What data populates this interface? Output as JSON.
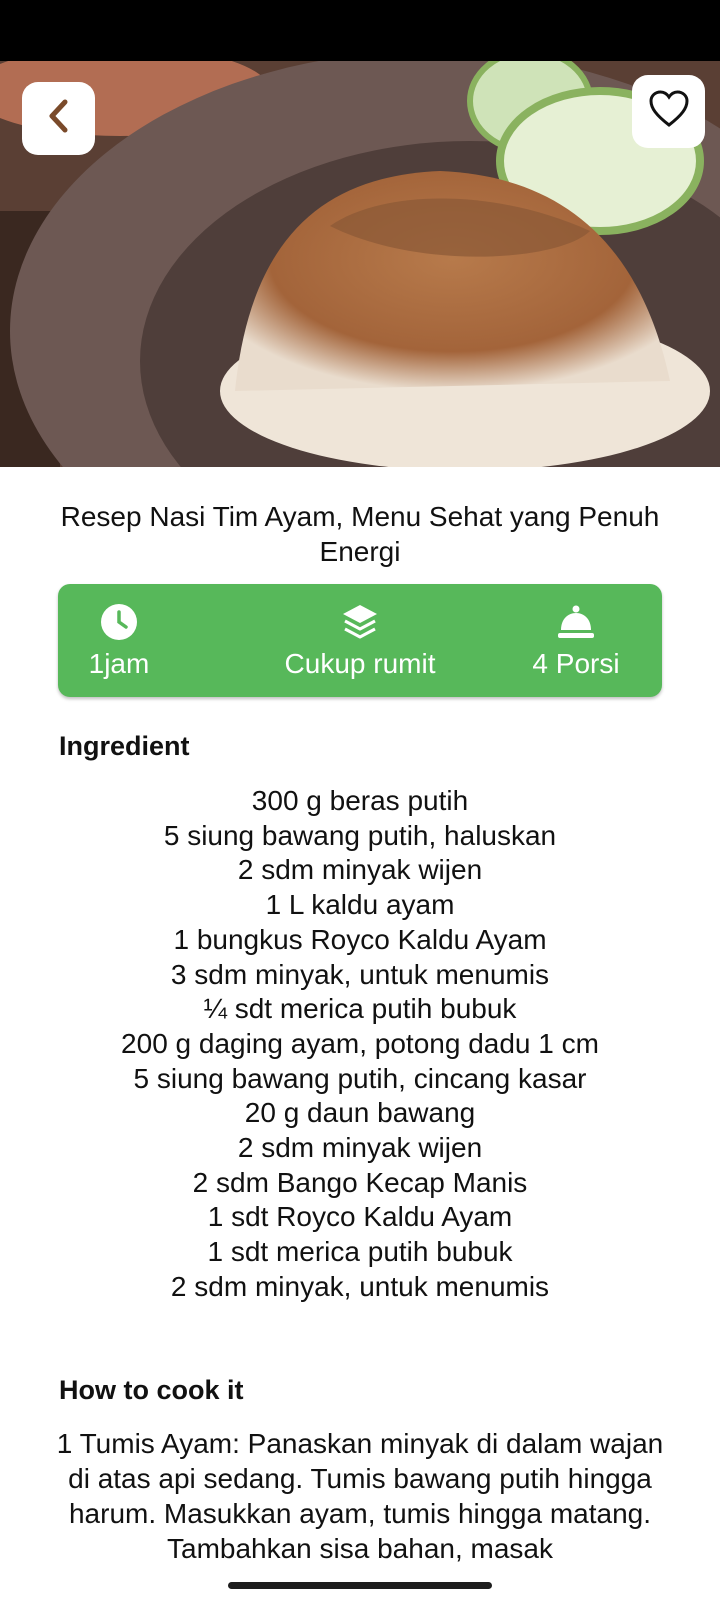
{
  "recipe": {
    "title": "Resep Nasi Tim Ayam, Menu Sehat yang Penuh Energi",
    "info": {
      "duration": "1jam",
      "difficulty": "Cukup rumit",
      "servings": "4 Porsi"
    },
    "ingredients_heading": "Ingredient",
    "ingredients": [
      "300 g beras putih",
      "5 siung bawang putih, haluskan",
      "2 sdm minyak wijen",
      "1 L kaldu ayam",
      "1 bungkus Royco Kaldu Ayam",
      "3 sdm minyak, untuk menumis",
      "¼ sdt merica putih bubuk",
      "200 g daging ayam, potong dadu 1 cm",
      "5 siung bawang putih, cincang kasar",
      "20 g daun bawang",
      "2 sdm minyak wijen",
      "2 sdm Bango Kecap Manis",
      "1 sdt Royco Kaldu Ayam",
      "1 sdt merica putih bubuk",
      "2 sdm minyak, untuk menumis"
    ],
    "steps_heading": "How to cook it",
    "steps_text": "1 Tumis Ayam: Panaskan minyak di dalam wajan di atas api sedang. Tumis bawang putih hingga harum. Masukkan ayam, tumis hingga matang. Tambahkan sisa bahan, masak"
  },
  "icons": {
    "back": "chevron-left-icon",
    "favorite": "heart-outline-icon",
    "duration": "clock-icon",
    "difficulty": "layers-icon",
    "servings": "serving-cloche-icon"
  },
  "colors": {
    "accent_green": "#57b85a",
    "back_chevron": "#7a4a2a"
  }
}
